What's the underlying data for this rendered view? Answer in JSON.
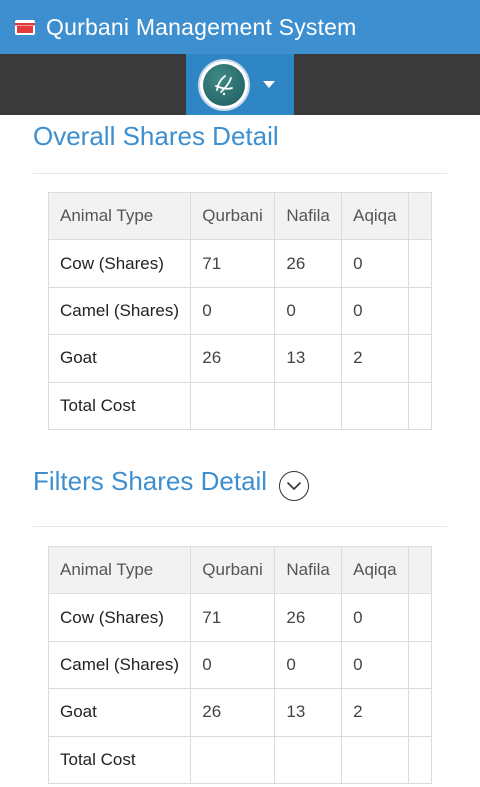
{
  "header": {
    "app_title": "Qurbani Management System",
    "icon": "kaaba-icon",
    "bar_color": "#3d8fd0"
  },
  "navbar": {
    "profile_icon": "islamic-calligraphy-logo",
    "dropdown_icon": "caret-down-icon"
  },
  "overall": {
    "title": "Overall Shares Detail",
    "columns": [
      "Animal Type",
      "Qurbani",
      "Nafila",
      "Aqiqa"
    ],
    "rows": [
      {
        "label": "Cow (Shares)",
        "qurbani": "71",
        "nafila": "26",
        "aqiqa": "0"
      },
      {
        "label": "Camel (Shares)",
        "qurbani": "0",
        "nafila": "0",
        "aqiqa": "0"
      },
      {
        "label": "Goat",
        "qurbani": "26",
        "nafila": "13",
        "aqiqa": "2"
      },
      {
        "label": "Total Cost",
        "qurbani": "",
        "nafila": "",
        "aqiqa": ""
      }
    ]
  },
  "filters": {
    "title": "Filters Shares Detail",
    "toggle_icon": "chevron-down-circle-icon",
    "columns": [
      "Animal Type",
      "Qurbani",
      "Nafila",
      "Aqiqa"
    ],
    "rows": [
      {
        "label": "Cow (Shares)",
        "qurbani": "71",
        "nafila": "26",
        "aqiqa": "0"
      },
      {
        "label": "Camel (Shares)",
        "qurbani": "0",
        "nafila": "0",
        "aqiqa": "0"
      },
      {
        "label": "Goat",
        "qurbani": "26",
        "nafila": "13",
        "aqiqa": "2"
      },
      {
        "label": "Total Cost",
        "qurbani": "",
        "nafila": "",
        "aqiqa": ""
      }
    ]
  }
}
